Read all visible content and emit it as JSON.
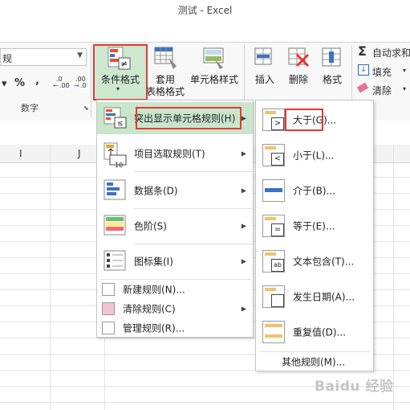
{
  "window": {
    "title": "测试 - Excel"
  },
  "ribbon": {
    "number_format_value": "规",
    "number_group_symbols": [
      "%",
      ","
    ],
    "number_group_label": "数字",
    "conditional_format": "条件格式",
    "format_as_table_line1": "套用",
    "format_as_table_line2": "表格格式",
    "cell_styles": "单元格样式",
    "insert": "插入",
    "delete": "删除",
    "format": "格式",
    "autosum": "自动求和",
    "fill": "填充",
    "clear": "清除",
    "dec_increase": ".00",
    "dec_decrease": ".0"
  },
  "sheet": {
    "columns": [
      "I",
      "J"
    ]
  },
  "menu_main": {
    "items": [
      {
        "label": "突出显示单元格规则(H)",
        "has_submenu": true
      },
      {
        "label": "项目选取规则(T)",
        "has_submenu": true
      },
      {
        "label": "数据条(D)",
        "has_submenu": true
      },
      {
        "label": "色阶(S)",
        "has_submenu": true
      },
      {
        "label": "图标集(I)",
        "has_submenu": true
      },
      {
        "label": "新建规则(N)...",
        "has_submenu": false
      },
      {
        "label": "清除规则(C)",
        "has_submenu": true
      },
      {
        "label": "管理规则(R)...",
        "has_submenu": false
      }
    ],
    "icon_number": "10"
  },
  "menu_sub": {
    "items": [
      {
        "label": "大于(G)..."
      },
      {
        "label": "小于(L)..."
      },
      {
        "label": "介于(B)..."
      },
      {
        "label": "等于(E)..."
      },
      {
        "label": "文本包含(T)..."
      },
      {
        "label": "发生日期(A)..."
      },
      {
        "label": "重复值(D)..."
      }
    ],
    "more": "其他规则(M)...",
    "icon_symbols": [
      ">",
      "<",
      "",
      "=",
      "ab",
      "",
      ""
    ]
  },
  "watermark": "Baidu 经验"
}
